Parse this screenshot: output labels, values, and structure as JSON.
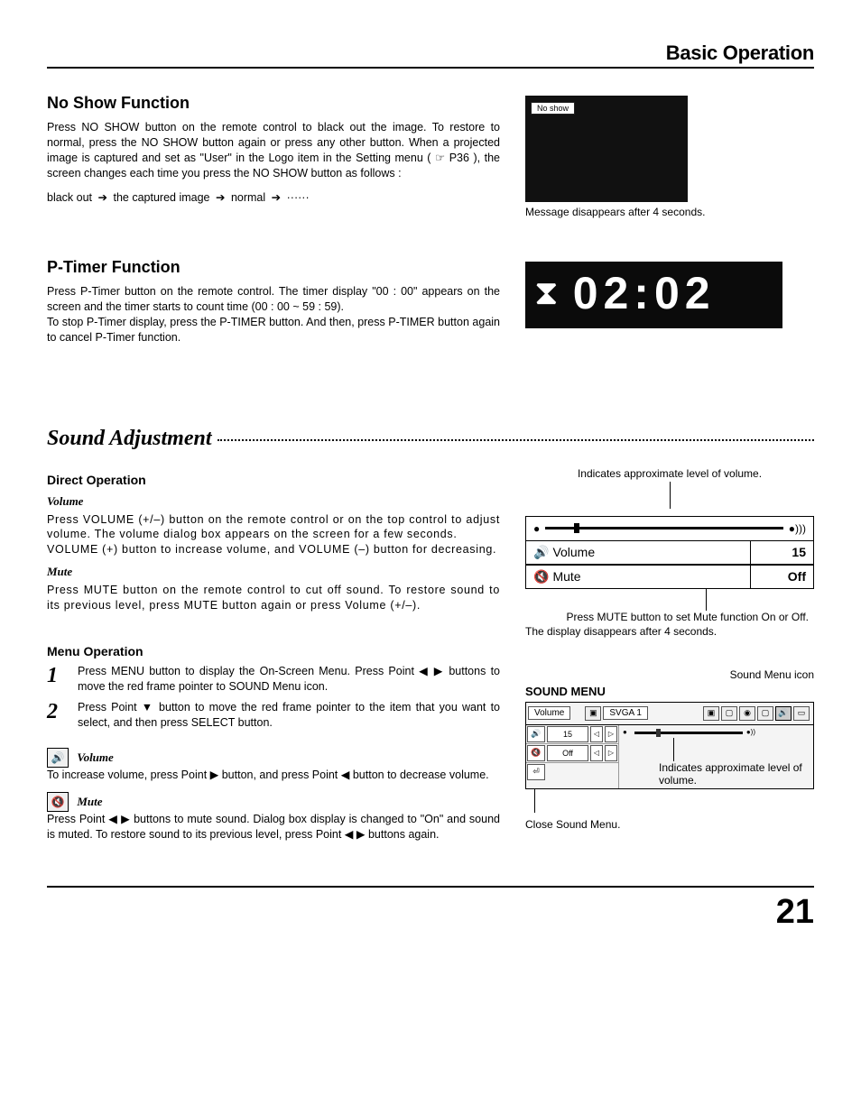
{
  "page": {
    "header": "Basic Operation",
    "number": "21"
  },
  "noshow": {
    "title": "No Show Function",
    "para": "Press NO SHOW button on the remote control to black out the image. To restore to normal, press the NO SHOW button again or press any other button.  When a projected image is captured and set as \"User\" in the Logo item in the Setting menu ( ☞ P36 ), the screen changes each time you press the NO SHOW button as follows :",
    "seq_a": "black out",
    "seq_b": "the captured image",
    "seq_c": "normal",
    "overlay": "No show",
    "caption": "Message disappears after 4 seconds."
  },
  "ptimer": {
    "title": "P-Timer Function",
    "para": "Press P-Timer button on the remote control.  The timer display \"00 : 00\" appears on the screen and the timer starts to count time (00 : 00 ~ 59 : 59).\nTo stop P-Timer display, press the P-TIMER button.  And then, press P-TIMER button again to cancel P-Timer function.",
    "display": "02:02"
  },
  "sound": {
    "title": "Sound Adjustment",
    "direct_title": "Direct Operation",
    "volume_title": "Volume",
    "volume_para": "Press VOLUME (+/–) button on the remote control or on the top control to adjust volume.  The volume dialog box appears on the screen for a few seconds.\n VOLUME (+) button to increase volume, and VOLUME (–) button  for decreasing.",
    "mute_title": "Mute",
    "mute_para": "Press MUTE button on the remote control to cut off sound.  To restore sound to its previous level, press MUTE button again or press Volume (+/–).",
    "menu_title": "Menu Operation",
    "step1": "Press MENU button to display the On-Screen Menu. Press Point ◀ ▶ buttons to move the red frame pointer to SOUND Menu icon.",
    "step2": "Press Point ▼ button to move the red frame pointer to the item that you want to select, and then press SELECT button.",
    "vol_sub": "Volume",
    "vol_sub_para": "To increase volume, press Point ▶ button, and press Point ◀ button to decrease volume.",
    "mute_sub": "Mute",
    "mute_sub_para": "Press Point ◀ ▶ buttons to mute sound. Dialog box display is changed to \"On\" and sound is muted.  To restore sound to its previous level, press Point ◀ ▶ buttons again.",
    "dialog": {
      "approx_label": "Indicates approximate level of volume.",
      "vol_label": "Volume",
      "vol_value": "15",
      "mute_label": "Mute",
      "mute_value": "Off",
      "mute_hint": "Press MUTE button to set Mute function On or Off.",
      "disappear": "The display disappears after 4 seconds."
    },
    "sm": {
      "icon_label": "Sound Menu icon",
      "title": "SOUND MENU",
      "caption_title": "Volume",
      "svga": "SVGA 1",
      "vol_value": "15",
      "mute_value": "Off",
      "approx": "Indicates approximate level of volume.",
      "close": "Close Sound Menu."
    }
  }
}
